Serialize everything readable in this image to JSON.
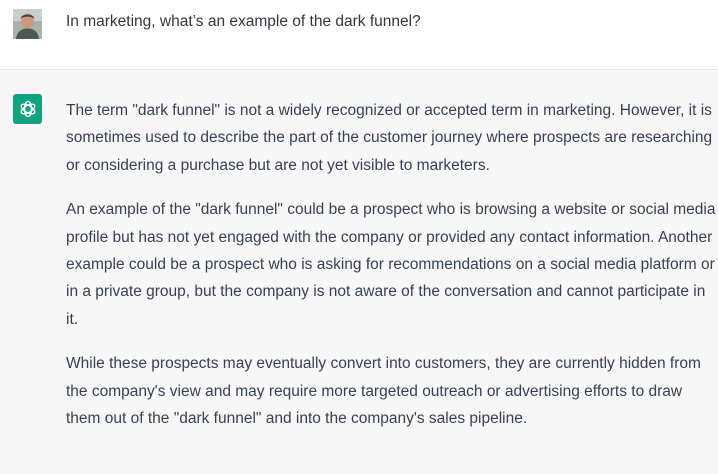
{
  "conversation": {
    "user_message": "In marketing, what’s an example of the dark funnel?",
    "assistant_message": {
      "paragraphs": [
        "The term \"dark funnel\" is not a widely recognized or accepted term in marketing. However, it is sometimes used to describe the part of the customer journey where prospects are researching or considering a purchase but are not yet visible to marketers.",
        "An example of the \"dark funnel\" could be a prospect who is browsing a website or social media profile but has not yet engaged with the company or provided any contact information. Another example could be a prospect who is asking for recommendations on a social media platform or in a private group, but the company is not aware of the conversation and cannot participate in it.",
        "While these prospects may eventually convert into customers, they are currently hidden from the company's view and may require more targeted outreach or advertising efforts to draw them out of the \"dark funnel\" and into the company's sales pipeline."
      ]
    }
  },
  "icons": {
    "user_avatar": "user-avatar-icon",
    "assistant_avatar": "openai-logo-icon"
  },
  "colors": {
    "assistant_avatar_bg": "#10a37f",
    "assistant_row_bg": "#f7f7f8",
    "user_row_bg": "#ffffff",
    "text": "#374151"
  }
}
